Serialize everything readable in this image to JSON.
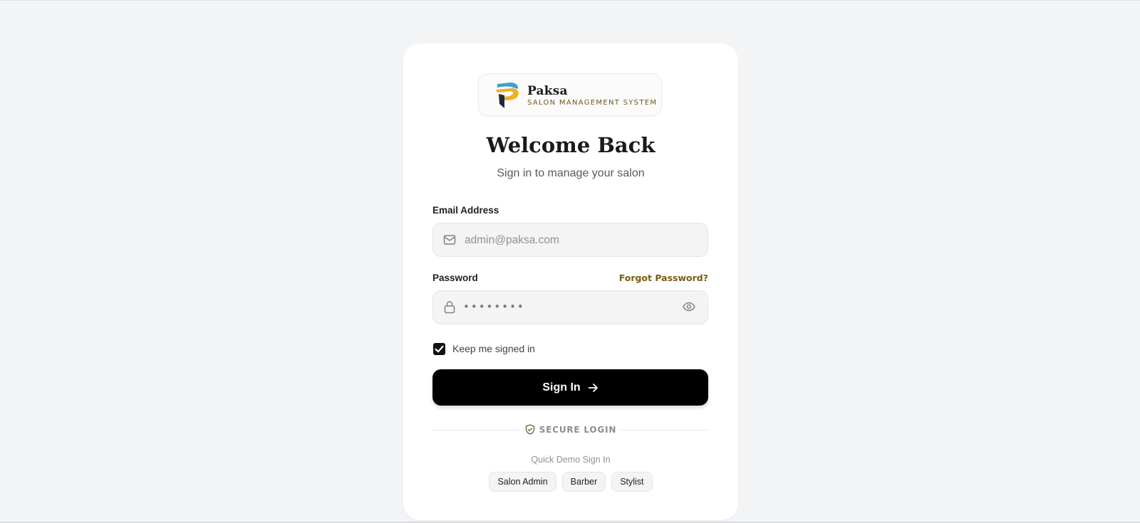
{
  "brand": {
    "name": "Paksa",
    "tagline": "SALON MANAGEMENT SYSTEM"
  },
  "heading": {
    "title": "Welcome Back",
    "subtitle": "Sign in to manage your salon"
  },
  "form": {
    "email": {
      "label": "Email Address",
      "placeholder": "admin@paksa.com",
      "icon": "mail-icon"
    },
    "password": {
      "label": "Password",
      "masked_value": "••••••••",
      "forgot_label": "Forgot Password?",
      "icon": "lock-icon",
      "toggle_icon": "eye-icon"
    },
    "remember": {
      "label": "Keep me signed in",
      "checked": true
    },
    "submit_label": "Sign In"
  },
  "secure": {
    "label": "SECURE LOGIN",
    "icon": "shield-check-icon"
  },
  "quick_demo": {
    "label": "Quick Demo Sign In",
    "options": [
      "Salon Admin",
      "Barber",
      "Stylist"
    ]
  },
  "colors": {
    "page_bg": "#f3f4f6",
    "card_bg": "#ffffff",
    "primary_button": "#000000",
    "accent_gold": "#7a5d14",
    "logo_yellow": "#f2b01e",
    "logo_blue": "#3b9fd6",
    "logo_dark": "#1f2937"
  }
}
